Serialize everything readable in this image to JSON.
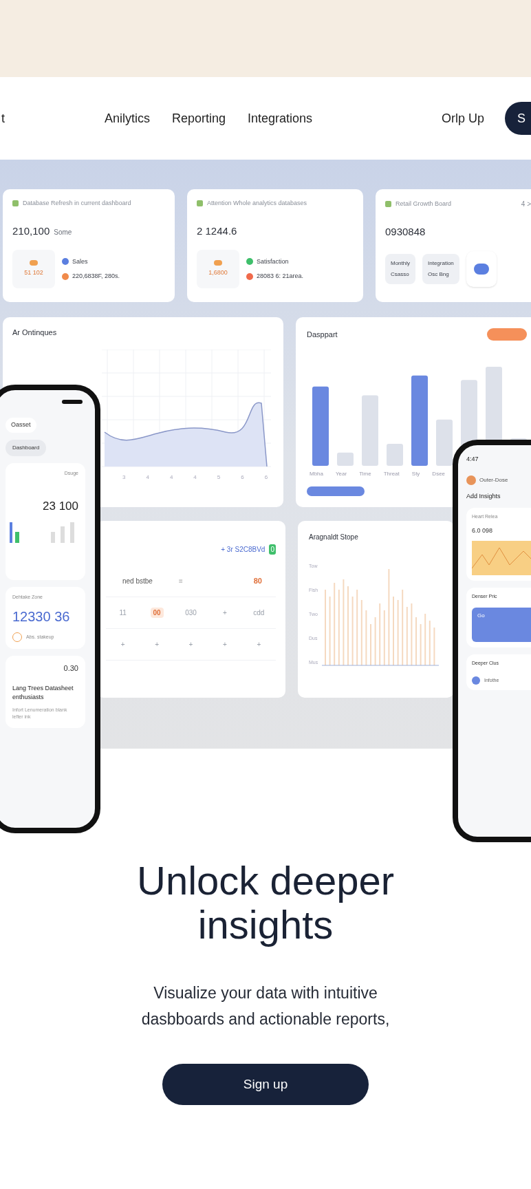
{
  "nav": {
    "brand": "t",
    "links": [
      {
        "label": "Anilytics"
      },
      {
        "label": "Reporting"
      },
      {
        "label": "Integrations"
      }
    ],
    "login": "Orlp Up",
    "cta": "S"
  },
  "dashboard": {
    "stat_cards": [
      {
        "title": "Database Refresh in current dashboard",
        "value": "210,100",
        "unit": "Some",
        "badge": "51 102",
        "legend": [
          {
            "label": "Sales",
            "color": "#5b7fe0"
          },
          {
            "label": "220,6838F, 280s.",
            "color": "#f08a4b"
          }
        ]
      },
      {
        "title": "Attention Whole analytics databases",
        "value": "2 1244.6",
        "badge": "1,6800",
        "legend": [
          {
            "label": "Satisfaction",
            "color": "#3fbf6b"
          },
          {
            "label": "28083 6: 21area.",
            "color": "#f06a4b"
          }
        ]
      },
      {
        "title": "Retail Growth Board",
        "value": "0930848",
        "pager": "4 >",
        "stats": [
          {
            "label": "Monthly",
            "value": "Csasso"
          },
          {
            "label": "Integration",
            "value": "Osc Bng"
          }
        ]
      }
    ],
    "line_chart": {
      "title": "Ar Ontinques",
      "xlabels": [
        "3",
        "4",
        "4",
        "4",
        "5",
        "6",
        "6"
      ]
    },
    "bar_chart": {
      "title": "Dasppart",
      "categories": [
        "Mbha",
        "Year",
        "Time",
        "Threat",
        "Sty",
        "Dsee"
      ]
    },
    "table_card": {
      "header": "+ 3r S2C8BVd",
      "badge": "0",
      "filter": {
        "label": "ned bstbe",
        "icon": "≡",
        "count": "80"
      },
      "rows": [
        [
          {
            "text": "11",
            "kind": "plain"
          },
          {
            "text": "00",
            "kind": "tag"
          },
          {
            "text": "030",
            "kind": "plain"
          },
          {
            "text": "+",
            "kind": "plain"
          },
          {
            "text": "cdd",
            "kind": "plain"
          }
        ],
        [
          {
            "text": "+",
            "kind": "plain"
          },
          {
            "text": "+",
            "kind": "plain"
          },
          {
            "text": "+",
            "kind": "plain"
          },
          {
            "text": "+",
            "kind": "plain"
          },
          {
            "text": "+",
            "kind": "plain"
          }
        ]
      ]
    },
    "histogram": {
      "title": "Aragnaldt Stope",
      "yticks": [
        "Tow",
        "Fish",
        "Two",
        "Dus",
        "Mus"
      ]
    }
  },
  "left_phone": {
    "chip": "Oasset",
    "pill": "Dashboard",
    "card1": {
      "caption": "Dsuge",
      "value": "23 100"
    },
    "card2": {
      "caption": "Dehtake Zone",
      "value": "12330 36",
      "note": "Abs. stakeup"
    },
    "card3": {
      "value": "0.30",
      "title": "Lang Trees Datasheet enthusiasts",
      "desc": "Infort Lenumeration blank lefter ink"
    }
  },
  "right_phone": {
    "time": "4:47",
    "user": "Outer-Dose",
    "heading": "Add Insights",
    "card1": {
      "caption": "Heart Relea",
      "value": "6.0 098"
    },
    "card2": {
      "title": "Denser Pric",
      "chip": "Go"
    },
    "card3": {
      "title": "Deeper Clus",
      "item": "Infothe"
    }
  },
  "hero": {
    "title": "Unlock deeper insights",
    "subtitle": "Visualize your data with intuitive dasbboards and actionable reports,",
    "button": "Sign up"
  }
}
